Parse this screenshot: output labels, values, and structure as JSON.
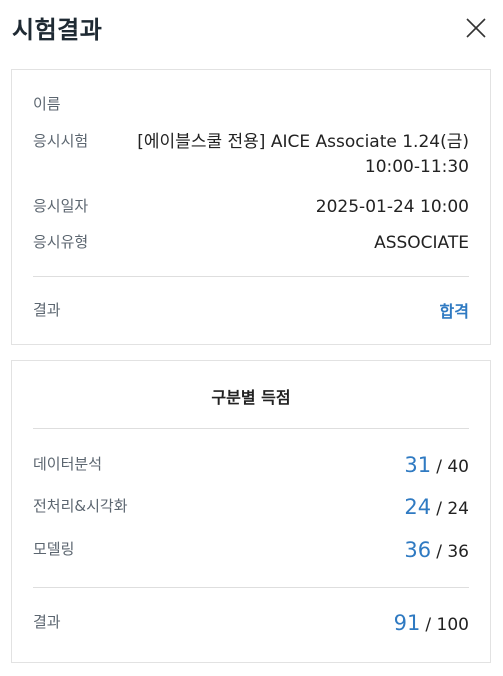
{
  "header": {
    "title": "시험결과"
  },
  "info": {
    "name_label": "이름",
    "name_value": "",
    "exam_label": "응시시험",
    "exam_line1": "[에이블스쿨 전용] AICE Associate 1.24(금)",
    "exam_line2": "10:00-11:30",
    "date_label": "응시일자",
    "date_value": "2025-01-24 10:00",
    "type_label": "응시유형",
    "type_value": "ASSOCIATE",
    "result_label": "결과",
    "result_value": "합격",
    "result_color": "#2f7ac2"
  },
  "scores": {
    "title": "구분별 득점",
    "items": [
      {
        "label": "데이터분석",
        "score": "31",
        "max": "/ 40"
      },
      {
        "label": "전처리&시각화",
        "score": "24",
        "max": "/ 24"
      },
      {
        "label": "모델링",
        "score": "36",
        "max": "/ 36"
      }
    ],
    "total_label": "결과",
    "total_score": "91",
    "total_max": "/ 100"
  },
  "icons": {
    "close": "close-icon"
  }
}
